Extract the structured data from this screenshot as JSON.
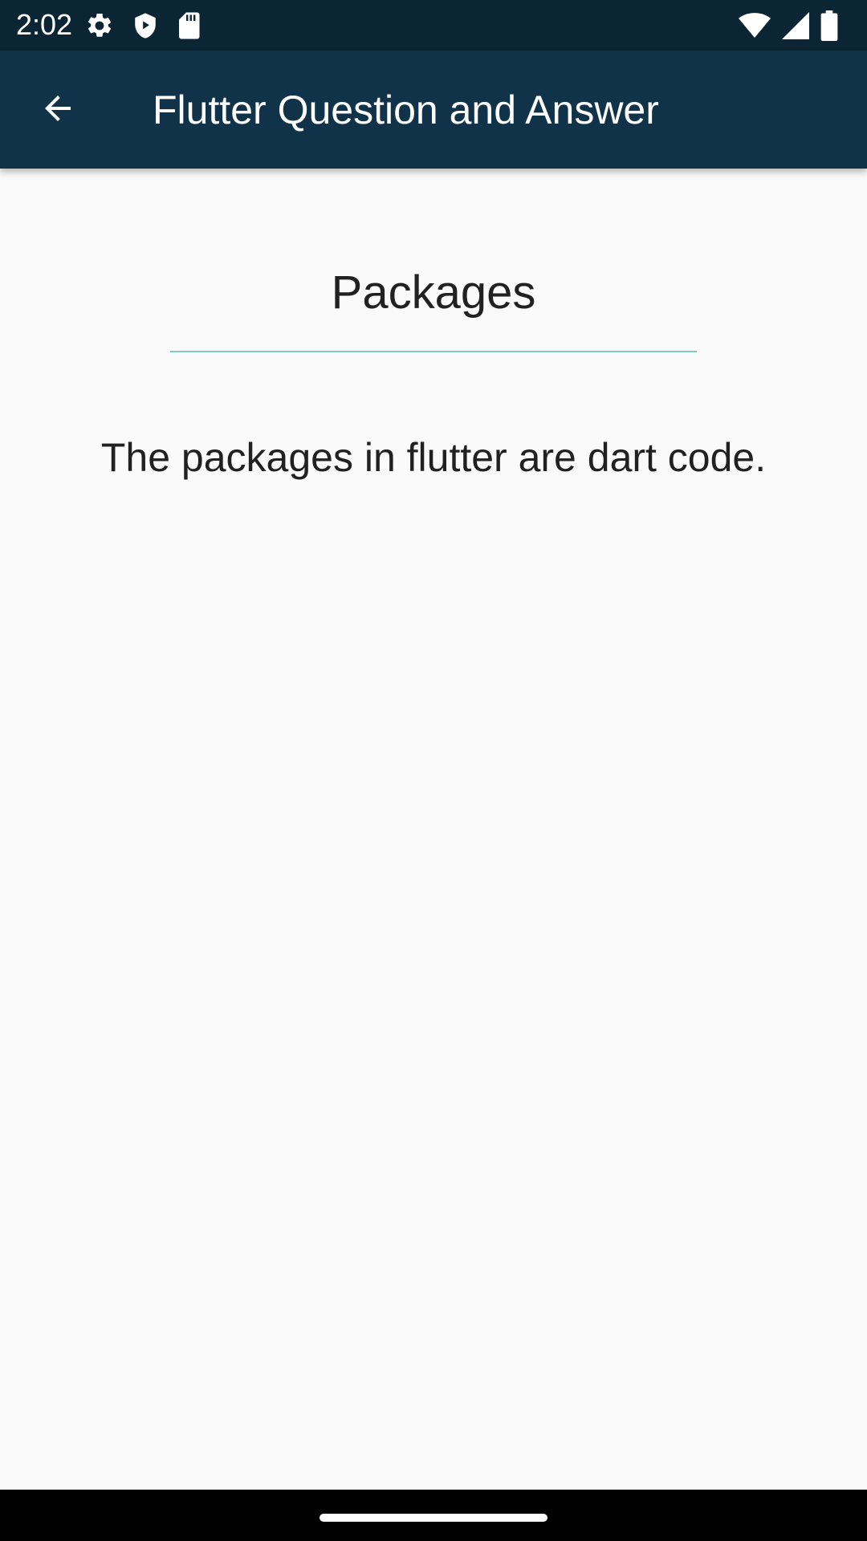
{
  "status_bar": {
    "time": "2:02",
    "left_icons": [
      "gear-icon",
      "shield-icon",
      "sd-card-icon"
    ],
    "right_icons": [
      "wifi-icon",
      "signal-icon",
      "battery-icon"
    ]
  },
  "app_bar": {
    "back_icon": "arrow-back-icon",
    "title": "Flutter Question and Answer",
    "color": "#113349"
  },
  "content": {
    "heading": "Packages",
    "answer": "The packages in flutter are dart code.",
    "divider_color": "#80cbc4"
  },
  "colors": {
    "status_bar": "#0c2535",
    "background": "#fafafa",
    "text": "#212121"
  }
}
